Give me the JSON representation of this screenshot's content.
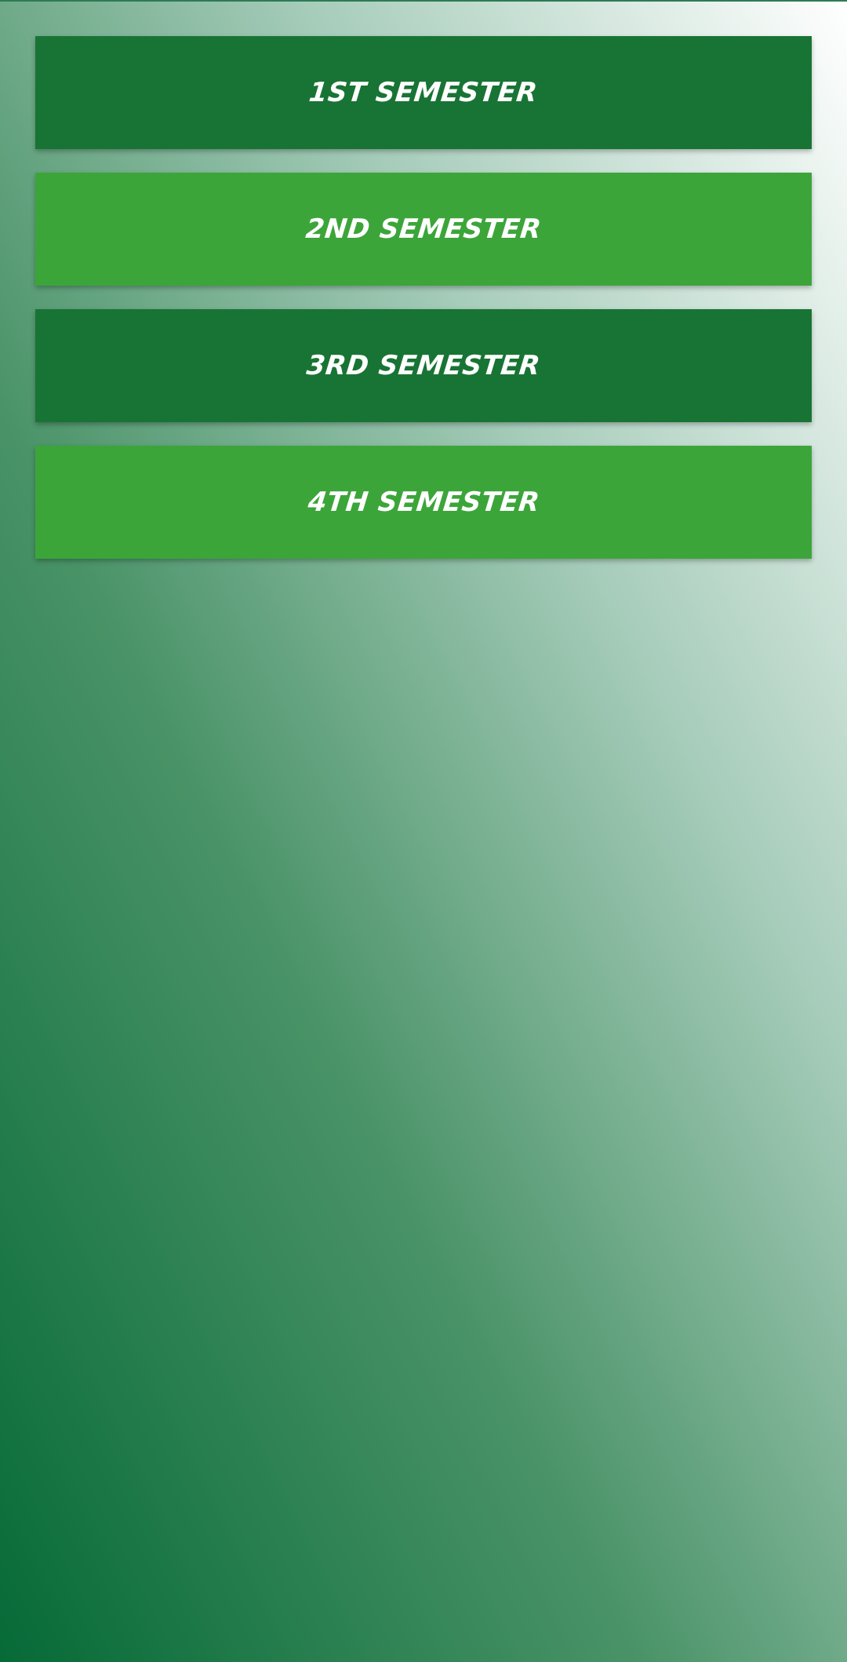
{
  "colors": {
    "dark_button": "#187434",
    "light_button": "#3ca53a",
    "label": "#ffffff",
    "gradient_bottom_left": "#066a37",
    "gradient_top_right": "#ffffff"
  },
  "semesters": [
    {
      "label": "1ST SEMESTER",
      "style": "dark"
    },
    {
      "label": "2ND SEMESTER",
      "style": "light"
    },
    {
      "label": "3RD SEMESTER",
      "style": "dark"
    },
    {
      "label": "4TH SEMESTER",
      "style": "light"
    }
  ]
}
